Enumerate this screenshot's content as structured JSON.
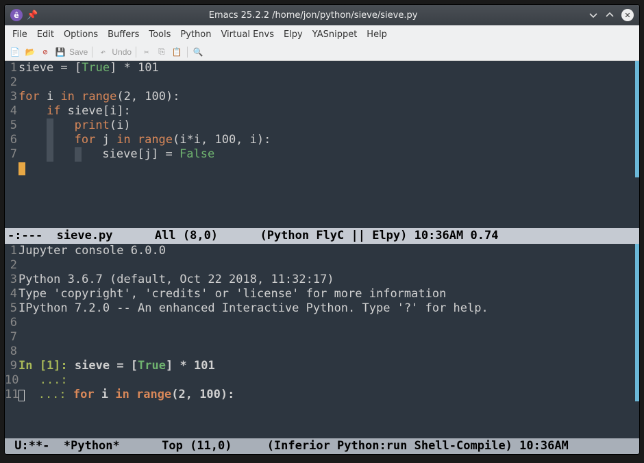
{
  "titlebar": {
    "title": "Emacs 25.2.2 /home/jon/python/sieve/sieve.py"
  },
  "menubar": {
    "items": [
      "File",
      "Edit",
      "Options",
      "Buffers",
      "Tools",
      "Python",
      "Virtual Envs",
      "Elpy",
      "YASnippet",
      "Help"
    ]
  },
  "toolbar": {
    "save": "Save",
    "undo": "Undo"
  },
  "code": {
    "l1_a": "sieve ",
    "l1_b": "=",
    "l1_c": " [",
    "l1_d": "True",
    "l1_e": "] ",
    "l1_f": "*",
    "l1_g": " 101",
    "l3_a": "for",
    "l3_b": " i ",
    "l3_c": "in",
    "l3_d": " ",
    "l3_e": "range",
    "l3_f": "(2, 100):",
    "l4_a": "if",
    "l4_b": " sieve[i]:",
    "l5_a": "print",
    "l5_b": "(i)",
    "l6_a": "for",
    "l6_b": " j ",
    "l6_c": "in",
    "l6_d": " ",
    "l6_e": "range",
    "l6_f": "(i",
    "l6_g": "*",
    "l6_h": "i, 100, i):",
    "l7_a": "sieve[j] ",
    "l7_b": "=",
    "l7_c": " ",
    "l7_d": "False"
  },
  "modeline1": "-:---  sieve.py      All (8,0)      (Python FlyC || Elpy) 10:36AM 0.74",
  "console": {
    "l1": "Jupyter console 6.0.0",
    "l3": "Python 3.6.7 (default, Oct 22 2018, 11:32:17)",
    "l4": "Type 'copyright', 'credits' or 'license' for more information",
    "l5": "IPython 7.2.0 -- An enhanced Interactive Python. Type '?' for help.",
    "l9_prompt": "In [1]: ",
    "l9_a": "sieve ",
    "l9_b": "=",
    "l9_c": " [",
    "l9_d": "True",
    "l9_e": "] ",
    "l9_f": "*",
    "l9_g": " 101",
    "l10_prompt": "   ...: ",
    "l11_prompt": "   ...: ",
    "l11_a": "for",
    "l11_b": " i ",
    "l11_c": "in",
    "l11_d": " ",
    "l11_e": "range",
    "l11_f": "(2, 100):"
  },
  "modeline2": " U:**-  *Python*      Top (11,0)     (Inferior Python:run Shell-Compile) 10:36AM",
  "linenums": {
    "n1": "1",
    "n2": "2",
    "n3": "3",
    "n4": "4",
    "n5": "5",
    "n6": "6",
    "n7": "7",
    "n8": "8",
    "n9": "9",
    "n10": "10",
    "n11": "11"
  }
}
